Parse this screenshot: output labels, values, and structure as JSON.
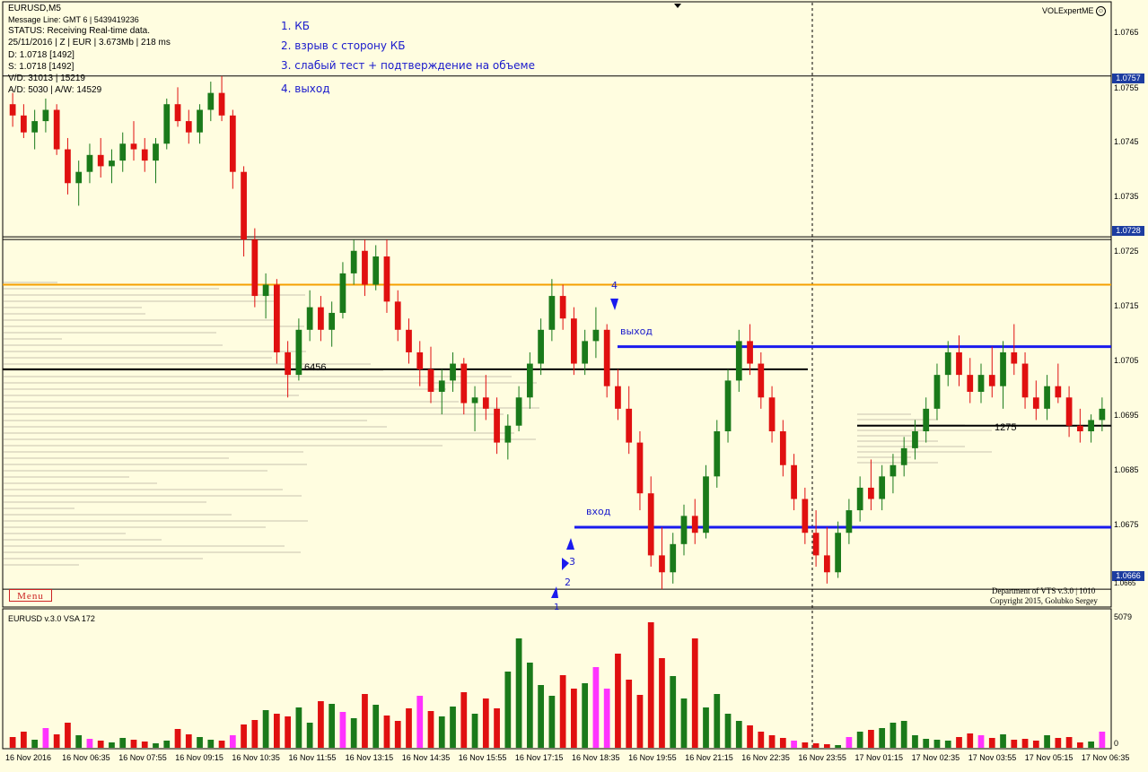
{
  "colors": {
    "background": "#fffde0",
    "bull": "#1a7a1a",
    "bear": "#e01010",
    "neutral_volume": "#ff33ff",
    "level_blue": "#1a1aee",
    "level_orange": "#f5a000",
    "level_black": "#000000",
    "price_box": "#1c3ca0",
    "annotation": "#1a1acc"
  },
  "header": {
    "symbol": "EURUSD,M5",
    "message_line": "Message Line: GMT 6  |  5439419236",
    "status": "STATUS:  Receiving Real-time data.",
    "session": "25/11/2016 | Z | EUR | 3.673Mb | 218 ms",
    "d_line": "D: 1.0718  [1492]",
    "s_line": "S: 1.0718  [1492]",
    "vd_line": "V/D: 31013 | 15219",
    "ad_line": "A/D: 5030 | A/W: 14529",
    "brand": "VOLExpertME",
    "brand_icon": "smiley-icon"
  },
  "notes": [
    "1. КБ",
    "2. взрыв с сторону КБ",
    "3. слабый тест + подтверждение на объеме",
    "4. выход"
  ],
  "price_axis": {
    "labels": [
      "1.0765",
      "1.0755",
      "1.0745",
      "1.0735",
      "1.0725",
      "1.0715",
      "1.0705",
      "1.0695",
      "1.0685",
      "1.0675",
      "1.0665"
    ],
    "highlighted": [
      "1.0757",
      "1.0728",
      "1.0666"
    ]
  },
  "volume_axis": {
    "max_label": "5079",
    "min_label": "0"
  },
  "indicator": {
    "title": "EURUSD v.3.0 VSA 172"
  },
  "time_axis": [
    "16 Nov 2016",
    "16 Nov 06:35",
    "16 Nov 07:55",
    "16 Nov 09:15",
    "16 Nov 10:35",
    "16 Nov 11:55",
    "16 Nov 13:15",
    "16 Nov 14:35",
    "16 Nov 15:55",
    "16 Nov 17:15",
    "16 Nov 18:35",
    "16 Nov 19:55",
    "16 Nov 21:15",
    "16 Nov 22:35",
    "16 Nov 23:55",
    "17 Nov 01:15",
    "17 Nov 02:35",
    "17 Nov 03:55",
    "17 Nov 05:15",
    "17 Nov 06:35"
  ],
  "menu": {
    "label": "Menu"
  },
  "annotations": {
    "entry_label": "вход",
    "exit_label": "выход",
    "marker_1": "1",
    "marker_2": "2",
    "marker_3": "3",
    "marker_4": "4",
    "level_label_left": "6456",
    "level_label_right": "1275"
  },
  "footer": {
    "department": "Department of VTS  v.3.0 | 1010",
    "copyright": "Copyright 2015, Golubko Sergey"
  },
  "chart_data": {
    "type": "candlestick",
    "symbol": "EURUSD",
    "timeframe": "M5",
    "ylim": [
      1.0663,
      1.077
    ],
    "levels": [
      1.0757,
      1.0728,
      1.072,
      1.0709,
      1.0705,
      1.0695,
      1.0677,
      1.0666
    ],
    "candles": [
      [
        1.0752,
        1.0754,
        1.0748,
        1.075
      ],
      [
        1.075,
        1.0752,
        1.0746,
        1.0747
      ],
      [
        1.0747,
        1.0751,
        1.0744,
        1.0749
      ],
      [
        1.0749,
        1.0753,
        1.0747,
        1.0751
      ],
      [
        1.0751,
        1.0752,
        1.0743,
        1.0744
      ],
      [
        1.0744,
        1.0746,
        1.0736,
        1.0738
      ],
      [
        1.0738,
        1.0742,
        1.0734,
        1.074
      ],
      [
        1.074,
        1.0745,
        1.0738,
        1.0743
      ],
      [
        1.0743,
        1.0746,
        1.0739,
        1.0741
      ],
      [
        1.0741,
        1.0744,
        1.0738,
        1.0742
      ],
      [
        1.0742,
        1.0747,
        1.074,
        1.0745
      ],
      [
        1.0745,
        1.0749,
        1.0742,
        1.0744
      ],
      [
        1.0744,
        1.0746,
        1.074,
        1.0742
      ],
      [
        1.0742,
        1.0746,
        1.0738,
        1.0745
      ],
      [
        1.0745,
        1.0753,
        1.0744,
        1.0752
      ],
      [
        1.0752,
        1.0755,
        1.0748,
        1.0749
      ],
      [
        1.0749,
        1.0751,
        1.0745,
        1.0747
      ],
      [
        1.0747,
        1.0752,
        1.0745,
        1.0751
      ],
      [
        1.0751,
        1.0756,
        1.0749,
        1.0754
      ],
      [
        1.0754,
        1.0757,
        1.0749,
        1.075
      ],
      [
        1.075,
        1.0751,
        1.0737,
        1.074
      ],
      [
        1.074,
        1.0741,
        1.0725,
        1.0728
      ],
      [
        1.0728,
        1.073,
        1.0716,
        1.0718
      ],
      [
        1.0718,
        1.0722,
        1.0714,
        1.072
      ],
      [
        1.072,
        1.0721,
        1.0706,
        1.0708
      ],
      [
        1.0708,
        1.071,
        1.07,
        1.0704
      ],
      [
        1.0704,
        1.0714,
        1.0703,
        1.0712
      ],
      [
        1.0712,
        1.0719,
        1.071,
        1.0716
      ],
      [
        1.0716,
        1.0718,
        1.071,
        1.0712
      ],
      [
        1.0712,
        1.0717,
        1.0709,
        1.0715
      ],
      [
        1.0715,
        1.0724,
        1.0714,
        1.0722
      ],
      [
        1.0722,
        1.0728,
        1.072,
        1.0726
      ],
      [
        1.0726,
        1.0728,
        1.0718,
        1.072
      ],
      [
        1.072,
        1.0727,
        1.0719,
        1.0725
      ],
      [
        1.0725,
        1.0728,
        1.0715,
        1.0717
      ],
      [
        1.0717,
        1.0719,
        1.071,
        1.0712
      ],
      [
        1.0712,
        1.0714,
        1.0706,
        1.0708
      ],
      [
        1.0708,
        1.071,
        1.0702,
        1.0705
      ],
      [
        1.0705,
        1.0709,
        1.0699,
        1.0701
      ],
      [
        1.0701,
        1.0705,
        1.0697,
        1.0703
      ],
      [
        1.0703,
        1.0708,
        1.0701,
        1.0706
      ],
      [
        1.0706,
        1.0707,
        1.0697,
        1.0699
      ],
      [
        1.0699,
        1.0702,
        1.0694,
        1.07
      ],
      [
        1.07,
        1.0704,
        1.0696,
        1.0698
      ],
      [
        1.0698,
        1.07,
        1.069,
        1.0692
      ],
      [
        1.0692,
        1.0697,
        1.0689,
        1.0695
      ],
      [
        1.0695,
        1.0702,
        1.0694,
        1.07
      ],
      [
        1.07,
        1.0708,
        1.0698,
        1.0706
      ],
      [
        1.0706,
        1.0714,
        1.0704,
        1.0712
      ],
      [
        1.0712,
        1.0721,
        1.071,
        1.0718
      ],
      [
        1.0718,
        1.072,
        1.0712,
        1.0714
      ],
      [
        1.0714,
        1.0716,
        1.0704,
        1.0706
      ],
      [
        1.0706,
        1.0712,
        1.0704,
        1.071
      ],
      [
        1.071,
        1.0716,
        1.0707,
        1.0712
      ],
      [
        1.0712,
        1.0713,
        1.07,
        1.0702
      ],
      [
        1.0702,
        1.0705,
        1.0696,
        1.0698
      ],
      [
        1.0698,
        1.0702,
        1.069,
        1.0692
      ],
      [
        1.0692,
        1.0694,
        1.068,
        1.0683
      ],
      [
        1.0683,
        1.0686,
        1.067,
        1.0672
      ],
      [
        1.0672,
        1.0677,
        1.0666,
        1.0669
      ],
      [
        1.0669,
        1.0676,
        1.0667,
        1.0674
      ],
      [
        1.0674,
        1.0681,
        1.0672,
        1.0679
      ],
      [
        1.0679,
        1.0682,
        1.0674,
        1.0676
      ],
      [
        1.0676,
        1.0688,
        1.0675,
        1.0686
      ],
      [
        1.0686,
        1.0696,
        1.0684,
        1.0694
      ],
      [
        1.0694,
        1.0705,
        1.0692,
        1.0703
      ],
      [
        1.0703,
        1.0712,
        1.0701,
        1.071
      ],
      [
        1.071,
        1.0713,
        1.0704,
        1.0706
      ],
      [
        1.0706,
        1.0708,
        1.0698,
        1.07
      ],
      [
        1.07,
        1.0702,
        1.0692,
        1.0694
      ],
      [
        1.0694,
        1.0696,
        1.0686,
        1.0688
      ],
      [
        1.0688,
        1.069,
        1.068,
        1.0682
      ],
      [
        1.0682,
        1.0684,
        1.0674,
        1.0676
      ],
      [
        1.0676,
        1.068,
        1.067,
        1.0672
      ],
      [
        1.0672,
        1.0677,
        1.0667,
        1.0669
      ],
      [
        1.0669,
        1.0678,
        1.0668,
        1.0676
      ],
      [
        1.0676,
        1.0682,
        1.0674,
        1.068
      ],
      [
        1.068,
        1.0686,
        1.0678,
        1.0684
      ],
      [
        1.0684,
        1.0689,
        1.068,
        1.0682
      ],
      [
        1.0682,
        1.0688,
        1.068,
        1.0686
      ],
      [
        1.0686,
        1.069,
        1.0683,
        1.0688
      ],
      [
        1.0688,
        1.0693,
        1.0686,
        1.0691
      ],
      [
        1.0691,
        1.0696,
        1.0689,
        1.0694
      ],
      [
        1.0694,
        1.07,
        1.0692,
        1.0698
      ],
      [
        1.0698,
        1.0706,
        1.0696,
        1.0704
      ],
      [
        1.0704,
        1.071,
        1.0702,
        1.0708
      ],
      [
        1.0708,
        1.0711,
        1.0702,
        1.0704
      ],
      [
        1.0704,
        1.0707,
        1.0699,
        1.0701
      ],
      [
        1.0701,
        1.0706,
        1.0699,
        1.0704
      ],
      [
        1.0704,
        1.0709,
        1.07,
        1.0702
      ],
      [
        1.0702,
        1.071,
        1.0698,
        1.0708
      ],
      [
        1.0708,
        1.0713,
        1.0704,
        1.0706
      ],
      [
        1.0706,
        1.0708,
        1.0698,
        1.07
      ],
      [
        1.07,
        1.0703,
        1.0696,
        1.0698
      ],
      [
        1.0698,
        1.0704,
        1.0696,
        1.0702
      ],
      [
        1.0702,
        1.0706,
        1.0699,
        1.07
      ],
      [
        1.07,
        1.0702,
        1.0693,
        1.0695
      ],
      [
        1.0695,
        1.0698,
        1.0692,
        1.0694
      ],
      [
        1.0694,
        1.0697,
        1.0692,
        1.0696
      ],
      [
        1.0696,
        1.07,
        1.0694,
        1.0698
      ]
    ],
    "volumes": [
      12,
      18,
      9,
      22,
      15,
      28,
      14,
      10,
      8,
      6,
      11,
      9,
      7,
      5,
      8,
      21,
      15,
      12,
      9,
      8,
      14,
      26,
      31,
      42,
      38,
      35,
      45,
      28,
      52,
      49,
      40,
      33,
      60,
      48,
      36,
      30,
      44,
      58,
      41,
      35,
      46,
      62,
      38,
      55,
      44,
      85,
      122,
      95,
      70,
      58,
      81,
      66,
      72,
      90,
      66,
      105,
      76,
      59,
      140,
      100,
      80,
      55,
      122,
      45,
      60,
      38,
      30,
      25,
      18,
      14,
      11,
      8,
      6,
      5,
      4,
      3,
      12,
      18,
      20,
      22,
      28,
      30,
      14,
      10,
      9,
      8,
      12,
      16,
      14,
      11,
      15,
      9,
      10,
      8,
      14,
      11,
      12,
      6,
      7,
      18
    ]
  }
}
